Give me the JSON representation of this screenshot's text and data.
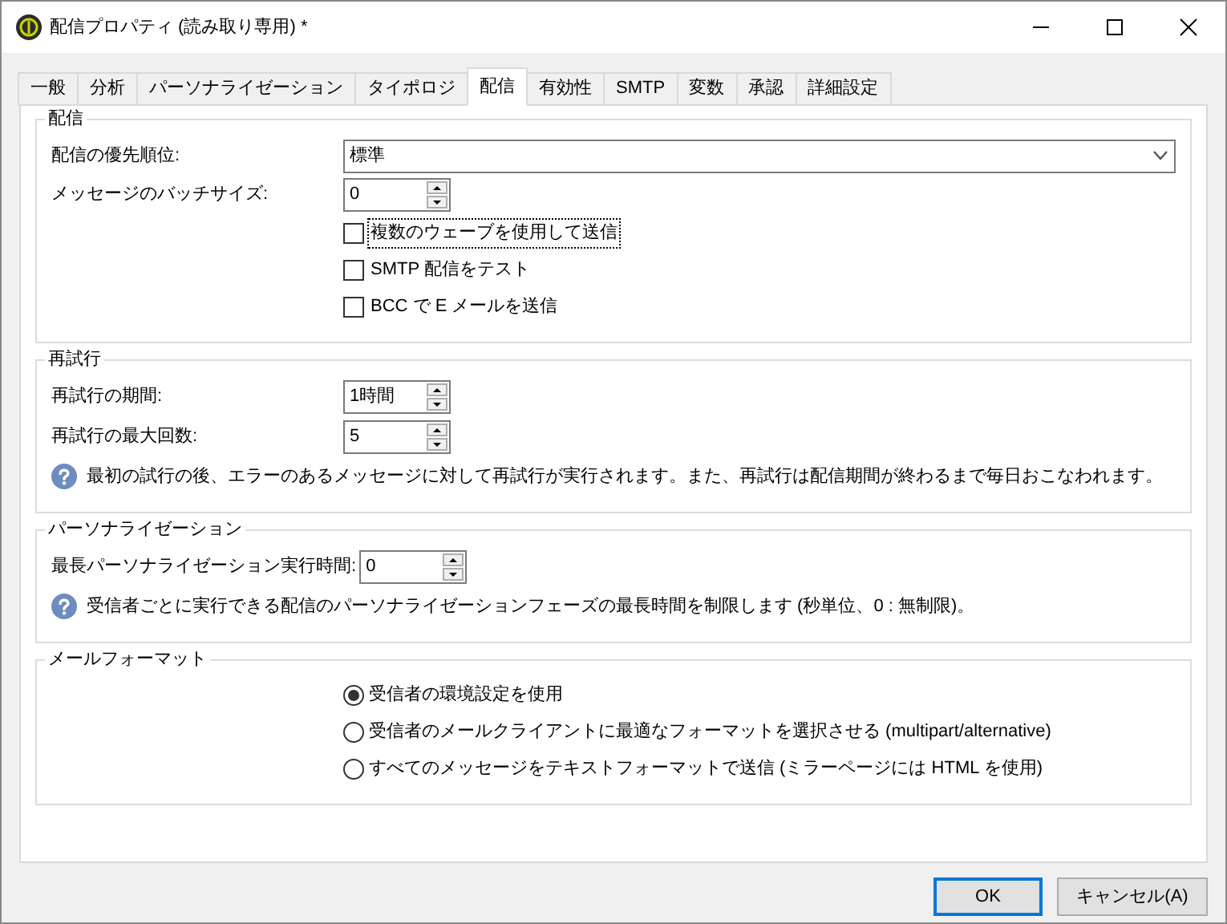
{
  "window": {
    "title": "配信プロパティ (読み取り専用) *"
  },
  "tabs": [
    {
      "label": "一般",
      "selected": false
    },
    {
      "label": "分析",
      "selected": false
    },
    {
      "label": "パーソナライゼーション",
      "selected": false
    },
    {
      "label": "タイポロジ",
      "selected": false
    },
    {
      "label": "配信",
      "selected": true
    },
    {
      "label": "有効性",
      "selected": false
    },
    {
      "label": "SMTP",
      "selected": false
    },
    {
      "label": "変数",
      "selected": false
    },
    {
      "label": "承認",
      "selected": false
    },
    {
      "label": "詳細設定",
      "selected": false
    }
  ],
  "groups": [
    {
      "title": "配信",
      "rows": [
        {
          "kind": "dropdown",
          "label": "配信の優先順位:",
          "value": "標準"
        },
        {
          "kind": "spinner",
          "label": "メッセージのバッチサイズ:",
          "value": "0"
        },
        {
          "kind": "checkbox",
          "label": "複数のウェーブを使用して送信",
          "checked": false,
          "focused": true
        },
        {
          "kind": "checkbox",
          "label": "SMTP 配信をテスト",
          "checked": false,
          "focused": false
        },
        {
          "kind": "checkbox",
          "label": "BCC で E メールを送信",
          "checked": false,
          "focused": false
        }
      ]
    },
    {
      "title": "再試行",
      "rows": [
        {
          "kind": "spinner",
          "label": "再試行の期間:",
          "value": "1時間"
        },
        {
          "kind": "spinner",
          "label": "再試行の最大回数:",
          "value": "5"
        },
        {
          "kind": "info",
          "text": "最初の試行の後、エラーのあるメッセージに対して再試行が実行されます。また、再試行は配信期間が終わるまで毎日おこなわれます。"
        }
      ]
    },
    {
      "title": "パーソナライゼーション",
      "rows": [
        {
          "kind": "spinner",
          "label": "最長パーソナライゼーション実行時間:",
          "value": "0"
        },
        {
          "kind": "info",
          "text": "受信者ごとに実行できる配信のパーソナライゼーションフェーズの最長時間を制限します (秒単位、0 : 無制限)。"
        }
      ]
    },
    {
      "title": "メールフォーマット",
      "rows": [
        {
          "kind": "radio",
          "label": "受信者の環境設定を使用",
          "selected": true
        },
        {
          "kind": "radio",
          "label": "受信者のメールクライアントに最適なフォーマットを選択させる (multipart/alternative)",
          "selected": false
        },
        {
          "kind": "radio",
          "label": "すべてのメッセージをテキストフォーマットで送信 (ミラーページには HTML を使用)",
          "selected": false
        }
      ]
    }
  ],
  "buttons": [
    {
      "label": "OK",
      "default": true
    },
    {
      "label": "キャンセル(A)",
      "default": false
    }
  ]
}
